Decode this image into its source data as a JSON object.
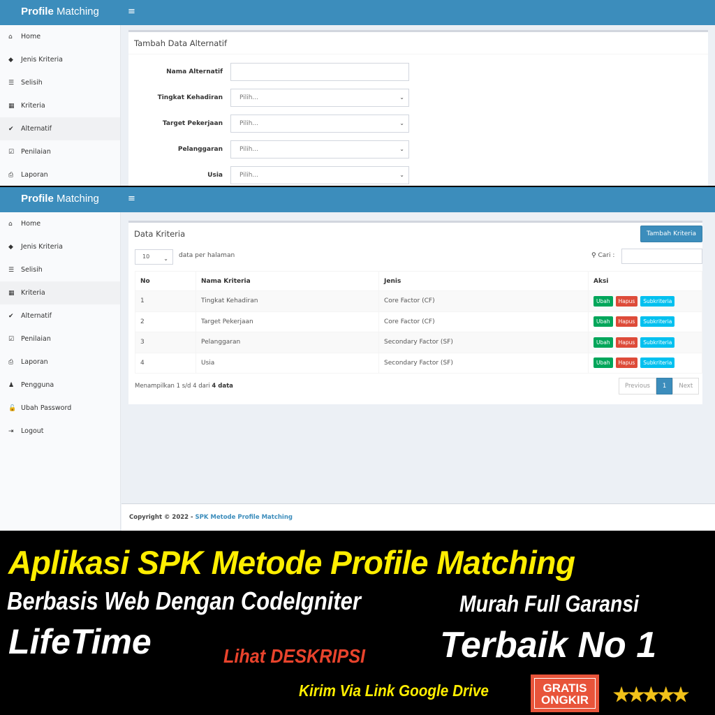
{
  "app": {
    "brand_bold": "Profile",
    "brand_light": " Matching",
    "menu_toggle_icon": "≡"
  },
  "top_screen": {
    "sidebar": [
      {
        "icon": "home-icon",
        "glyph": "⌂",
        "label": "Home",
        "active": false
      },
      {
        "icon": "tags-icon",
        "glyph": "◆",
        "label": "Jenis Kriteria",
        "active": false
      },
      {
        "icon": "list-icon",
        "glyph": "☰",
        "label": "Selisih",
        "active": false
      },
      {
        "icon": "grid-icon",
        "glyph": "▦",
        "label": "Kriteria",
        "active": false
      },
      {
        "icon": "check-icon",
        "glyph": "✔",
        "label": "Alternatif",
        "active": true
      },
      {
        "icon": "check-square-icon",
        "glyph": "☑",
        "label": "Penilaian",
        "active": false
      },
      {
        "icon": "print-icon",
        "glyph": "⎙",
        "label": "Laporan",
        "active": false
      }
    ],
    "form": {
      "title": "Tambah Data Alternatif",
      "fields": [
        {
          "label": "Nama Alternatif",
          "type": "text",
          "value": ""
        },
        {
          "label": "Tingkat Kehadiran",
          "type": "select",
          "value": "Pilih..."
        },
        {
          "label": "Target Pekerjaan",
          "type": "select",
          "value": "Pilih..."
        },
        {
          "label": "Pelanggaran",
          "type": "select",
          "value": "Pilih..."
        },
        {
          "label": "Usia",
          "type": "select",
          "value": "Pilih..."
        }
      ]
    }
  },
  "bottom_screen": {
    "sidebar": [
      {
        "icon": "home-icon",
        "glyph": "⌂",
        "label": "Home",
        "active": false
      },
      {
        "icon": "tags-icon",
        "glyph": "◆",
        "label": "Jenis Kriteria",
        "active": false
      },
      {
        "icon": "list-icon",
        "glyph": "☰",
        "label": "Selisih",
        "active": false
      },
      {
        "icon": "grid-icon",
        "glyph": "▦",
        "label": "Kriteria",
        "active": true
      },
      {
        "icon": "check-icon",
        "glyph": "✔",
        "label": "Alternatif",
        "active": false
      },
      {
        "icon": "check-square-icon",
        "glyph": "☑",
        "label": "Penilaian",
        "active": false
      },
      {
        "icon": "print-icon",
        "glyph": "⎙",
        "label": "Laporan",
        "active": false
      },
      {
        "icon": "user-icon",
        "glyph": "♟",
        "label": "Pengguna",
        "active": false
      },
      {
        "icon": "unlock-icon",
        "glyph": "🔓",
        "label": "Ubah Password",
        "active": false
      },
      {
        "icon": "sign-out-icon",
        "glyph": "⇥",
        "label": "Logout",
        "active": false
      }
    ],
    "table_box": {
      "title": "Data Kriteria",
      "add_button": "Tambah Kriteria",
      "page_size": "10",
      "page_size_label": "data per halaman",
      "search_label": "Cari :",
      "search_value": "",
      "columns": [
        "No",
        "Nama Kriteria",
        "Jenis",
        "Aksi"
      ],
      "rows": [
        {
          "no": "1",
          "nama": "Tingkat Kehadiran",
          "jenis": "Core Factor (CF)"
        },
        {
          "no": "2",
          "nama": "Target Pekerjaan",
          "jenis": "Core Factor (CF)"
        },
        {
          "no": "3",
          "nama": "Pelanggaran",
          "jenis": "Secondary Factor (SF)"
        },
        {
          "no": "4",
          "nama": "Usia",
          "jenis": "Secondary Factor (SF)"
        }
      ],
      "actions": {
        "edit": "Ubah",
        "delete": "Hapus",
        "sub": "Subkriteria"
      },
      "info_prefix": "Menampilkan 1 s/d 4 dari ",
      "info_bold": "4 data",
      "pagination": {
        "previous": "Previous",
        "current": "1",
        "next": "Next"
      }
    },
    "footer": {
      "copyright": "Copyright © 2022 - ",
      "link": "SPK Metode Profile Matching"
    }
  },
  "promo": {
    "title": "Aplikasi SPK Metode Profile Matching",
    "sub1": "Berbasis Web Dengan CodeIgniter",
    "sub2": "Murah Full Garansi",
    "lifetime": "LifeTime",
    "lihat": "Lihat DESKRIPSI",
    "terbaik": "Terbaik No 1",
    "kirim": "Kirim Via Link Google Drive",
    "badge_line1": "GRATIS",
    "badge_line2": "ONGKIR",
    "rating_stars": 5,
    "stars_text": "★★★★★",
    "colors": {
      "yellow": "#ffee00",
      "red": "#e8432c",
      "white": "#ffffff",
      "badge": "#e8543a"
    }
  }
}
